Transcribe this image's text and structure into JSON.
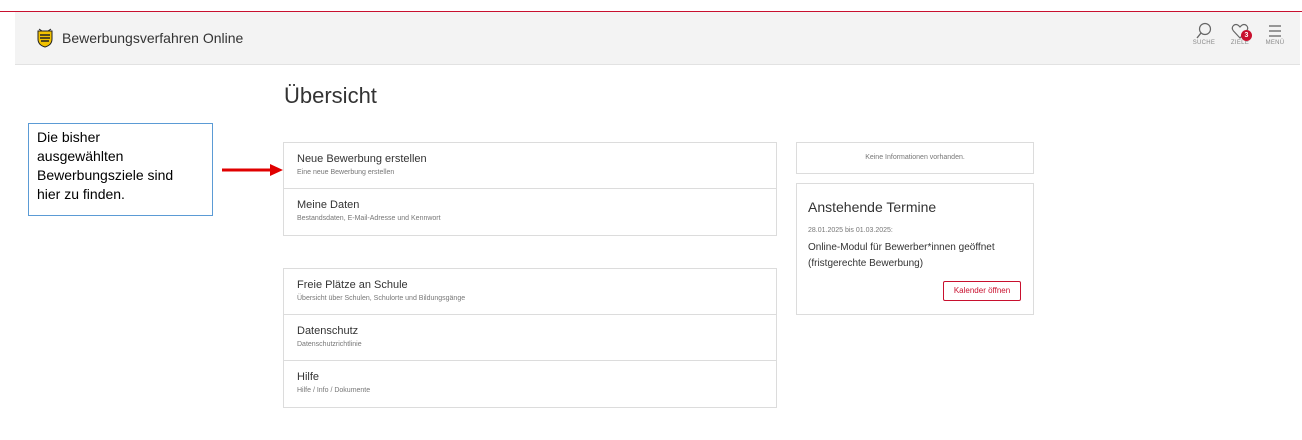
{
  "header": {
    "app_title": "Bewerbungsverfahren Online",
    "search_label": "SUCHE",
    "goals_label": "ZIELE",
    "goals_badge": "3",
    "menu_label": "MENÜ"
  },
  "page_title": "Übersicht",
  "callout_text": "Die bisher\nausgewählten\nBewerbungsziele sind\nhier zu finden.",
  "card1": [
    {
      "title": "Neue Bewerbung erstellen",
      "subtitle": "Eine neue Bewerbung erstellen"
    },
    {
      "title": "Meine Daten",
      "subtitle": "Bestandsdaten, E-Mail-Adresse und Kennwort"
    }
  ],
  "card2": [
    {
      "title": "Freie Plätze an Schule",
      "subtitle": "Übersicht über Schulen, Schulorte und Bildungsgänge"
    },
    {
      "title": "Datenschutz",
      "subtitle": "Datenschutzrichtlinie"
    },
    {
      "title": "Hilfe",
      "subtitle": "Hilfe / Info / Dokumente"
    }
  ],
  "info_text": "Keine Informationen vorhanden.",
  "termine": {
    "title": "Anstehende Termine",
    "date": "28.01.2025 bis 01.03.2025:",
    "description": "Online-Modul für Bewerber*innen geöffnet (fristgerechte Bewerbung)",
    "button": "Kalender öffnen"
  },
  "colors": {
    "accent": "#c8102e",
    "callout_border": "#5b9bd5",
    "header_bg": "#f3f3f3"
  }
}
